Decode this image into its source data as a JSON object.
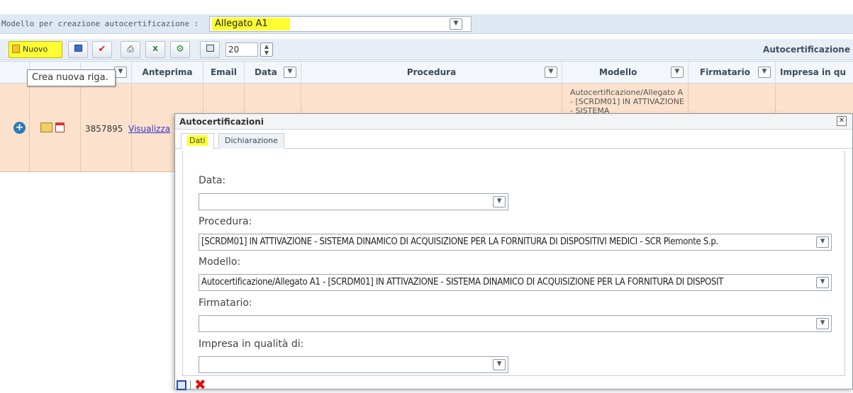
{
  "model_bar": {
    "label": "Modello per creazione autocertificazione :",
    "selected": "Allegato A1"
  },
  "toolbar": {
    "nuovo_label": "Nuovo",
    "page_size": "20",
    "title": "Autocertificazione"
  },
  "tooltip": "Crea nuova riga.",
  "grid": {
    "columns": [
      "Anteprima",
      "Email",
      "Data",
      "Procedura",
      "Modello",
      "Firmatario",
      "Impresa in qu"
    ],
    "row": {
      "id": "3857895",
      "link": "Visualizza",
      "modello": "Autocertificazione/Allegato A - [SCRDM01] IN ATTIVAZIONE - SISTEMA"
    }
  },
  "dialog": {
    "title": "Autocertificazioni",
    "tabs": [
      "Dati",
      "Dichiarazione"
    ],
    "fields": {
      "data_label": "Data:",
      "data_value": "",
      "procedura_label": "Procedura:",
      "procedura_value": "[SCRDM01] IN ATTIVAZIONE - SISTEMA DINAMICO DI ACQUISIZIONE PER LA FORNITURA DI DISPOSITIVI MEDICI - SCR Piemonte S.p.",
      "modello_label": "Modello:",
      "modello_value": "Autocertificazione/Allegato A1 - [SCRDM01] IN ATTIVAZIONE - SISTEMA DINAMICO DI ACQUISIZIONE PER LA FORNITURA DI DISPOSIT",
      "firmatario_label": "Firmatario:",
      "firmatario_value": "",
      "impresa_label": "Impresa in qualità di:",
      "impresa_value": ""
    }
  },
  "colors": {
    "highlight": "#ffff33",
    "row_bg": "#fce2cd",
    "bar_bg": "#dfe8f2"
  }
}
